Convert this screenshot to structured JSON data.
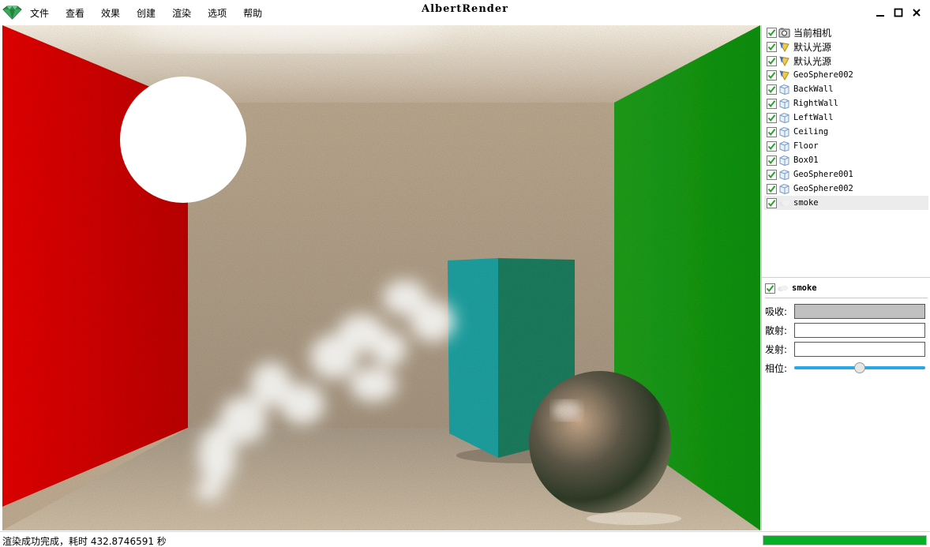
{
  "app": {
    "title": "AlbertRender",
    "logo_icon": "emerald-gem-icon"
  },
  "menu": {
    "items": [
      "文件",
      "查看",
      "效果",
      "创建",
      "渲染",
      "选项",
      "帮助"
    ]
  },
  "window_controls": [
    "minimize-icon",
    "maximize-icon",
    "close-icon"
  ],
  "render_view": {
    "description_icon": "rendered-scene-image"
  },
  "scene_tree": {
    "items": [
      {
        "label": "当前相机",
        "icon": "camera-icon",
        "checked": true
      },
      {
        "label": "默认光源",
        "icon": "light-icon",
        "checked": true
      },
      {
        "label": "默认光源",
        "icon": "light-icon",
        "checked": true
      },
      {
        "label": "GeoSphere002",
        "icon": "light-icon",
        "checked": true
      },
      {
        "label": "BackWall",
        "icon": "mesh-icon",
        "checked": true
      },
      {
        "label": "RightWall",
        "icon": "mesh-icon",
        "checked": true
      },
      {
        "label": "LeftWall",
        "icon": "mesh-icon",
        "checked": true
      },
      {
        "label": "Ceiling",
        "icon": "mesh-icon",
        "checked": true
      },
      {
        "label": "Floor",
        "icon": "mesh-icon",
        "checked": true
      },
      {
        "label": "Box01",
        "icon": "mesh-icon",
        "checked": true
      },
      {
        "label": "GeoSphere001",
        "icon": "mesh-icon",
        "checked": true
      },
      {
        "label": "GeoSphere002",
        "icon": "mesh-icon",
        "checked": true
      },
      {
        "label": "smoke",
        "icon": "smoke-icon",
        "checked": true,
        "selected": true
      }
    ]
  },
  "properties": {
    "object_name": "smoke",
    "object_icon": "smoke-icon",
    "checked": true,
    "absorb_label": "吸收:",
    "absorb_color": "#c0c0c0",
    "scatter_label": "散射:",
    "scatter_color": "#ffffff",
    "emit_label": "发射:",
    "emit_color": "#ffffff",
    "phase_label": "相位:",
    "phase_value": 0.5,
    "slider_color": "#29a8e6"
  },
  "status": {
    "text": "渲染成功完成，耗时 432.8746591 秒",
    "progress": 1.0,
    "progress_color": "#06b025"
  }
}
